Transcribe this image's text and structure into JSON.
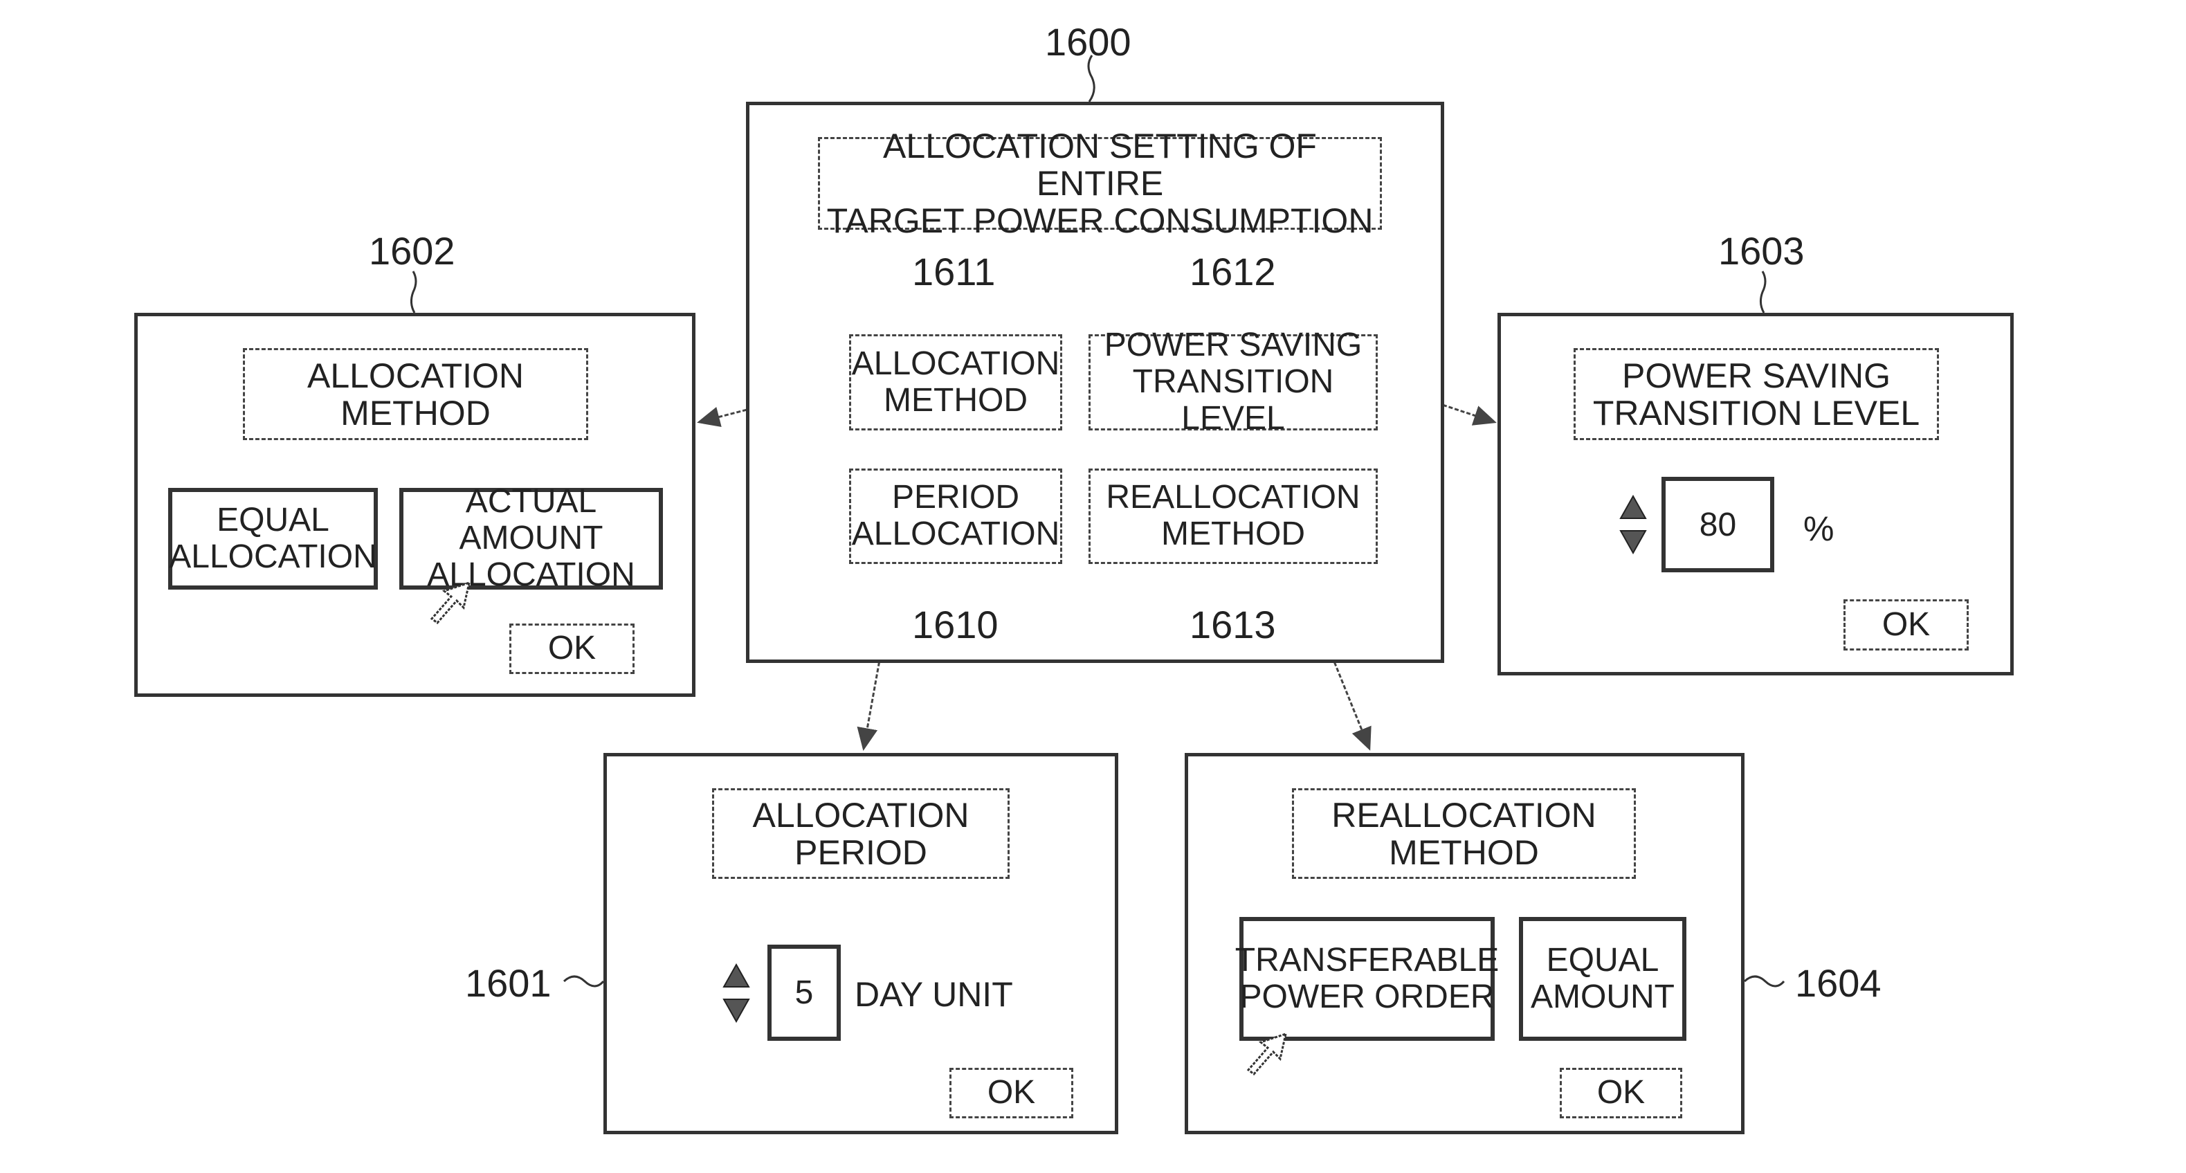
{
  "figure": {
    "main_panel": {
      "ref": "1600",
      "title": "ALLOCATION SETTING OF ENTIRE\nTARGET POWER CONSUMPTION",
      "buttons": [
        {
          "ref": "1611",
          "label": "ALLOCATION\nMETHOD"
        },
        {
          "ref": "1612",
          "label": "POWER SAVING\nTRANSITION LEVEL"
        },
        {
          "ref": "1610",
          "label": "PERIOD\nALLOCATION"
        },
        {
          "ref": "1613",
          "label": "REALLOCATION\nMETHOD"
        }
      ]
    },
    "allocation_method_panel": {
      "ref": "1602",
      "title": "ALLOCATION\nMETHOD",
      "options": [
        "EQUAL\nALLOCATION",
        "ACTUAL AMOUNT\nALLOCATION"
      ],
      "selected_option": "ACTUAL AMOUNT ALLOCATION",
      "ok_label": "OK"
    },
    "power_saving_panel": {
      "ref": "1603",
      "title": "POWER SAVING\nTRANSITION LEVEL",
      "value": "80",
      "unit": "%",
      "ok_label": "OK"
    },
    "allocation_period_panel": {
      "ref": "1601",
      "title": "ALLOCATION\nPERIOD",
      "value": "5",
      "unit": "DAY UNIT",
      "ok_label": "OK"
    },
    "reallocation_method_panel": {
      "ref": "1604",
      "title": "REALLOCATION\nMETHOD",
      "options": [
        "TRANSFERABLE\nPOWER ORDER",
        "EQUAL\nAMOUNT"
      ],
      "selected_option": "TRANSFERABLE POWER ORDER",
      "ok_label": "OK"
    },
    "icons": {
      "spinner_up": "triangle-up",
      "spinner_down": "triangle-down",
      "pointer": "mouse-pointer-arrow"
    }
  }
}
